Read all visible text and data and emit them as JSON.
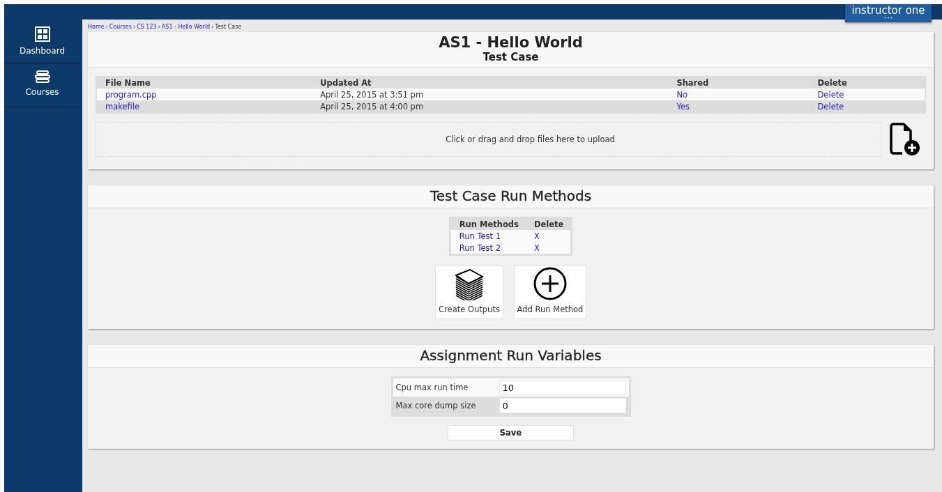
{
  "user_menu": {
    "name": "instructor one"
  },
  "sidebar": {
    "items": [
      {
        "label": "Dashboard",
        "kind": "dashboard"
      },
      {
        "label": "Courses",
        "kind": "courses"
      }
    ]
  },
  "breadcrumb": {
    "items": [
      {
        "text": "Home",
        "kind": "link"
      },
      {
        "text": "›",
        "kind": "separator"
      },
      {
        "text": "Courses",
        "kind": "link"
      },
      {
        "text": "›",
        "kind": "separator"
      },
      {
        "text": "CS 123",
        "kind": "link"
      },
      {
        "text": "›",
        "kind": "separator"
      },
      {
        "text": "AS1 - Hello World",
        "kind": "link"
      },
      {
        "text": "›",
        "kind": "separator"
      },
      {
        "text": "Test Case",
        "kind": "current"
      }
    ]
  },
  "header": {
    "title": "AS1 - Hello World",
    "subtitle": "Test Case"
  },
  "files": {
    "columns": [
      "File Name",
      "Updated At",
      "Shared",
      "Delete"
    ],
    "rows": [
      {
        "name": "program.cpp",
        "updated": "April 25, 2015 at 3:51 pm",
        "shared": "No",
        "delete": "Delete"
      },
      {
        "name": "makefile",
        "updated": "April 25, 2015 at 4:00 pm",
        "shared": "Yes",
        "delete": "Delete"
      }
    ],
    "dropzone": "Click or drag and drop files here to upload"
  },
  "run_methods": {
    "title": "Test Case Run Methods",
    "columns": [
      "Run Methods",
      "Delete"
    ],
    "rows": [
      {
        "name": "Run Test 1",
        "delete": "X"
      },
      {
        "name": "Run Test 2",
        "delete": "X"
      }
    ],
    "actions": [
      {
        "label": "Create Outputs",
        "kind": "stack"
      },
      {
        "label": "Add Run Method",
        "kind": "add"
      }
    ]
  },
  "run_variables": {
    "title": "Assignment Run Variables",
    "fields": [
      {
        "label": "Cpu max run time",
        "value": "10"
      },
      {
        "label": "Max core dump size",
        "value": "0"
      }
    ],
    "save": "Save"
  }
}
